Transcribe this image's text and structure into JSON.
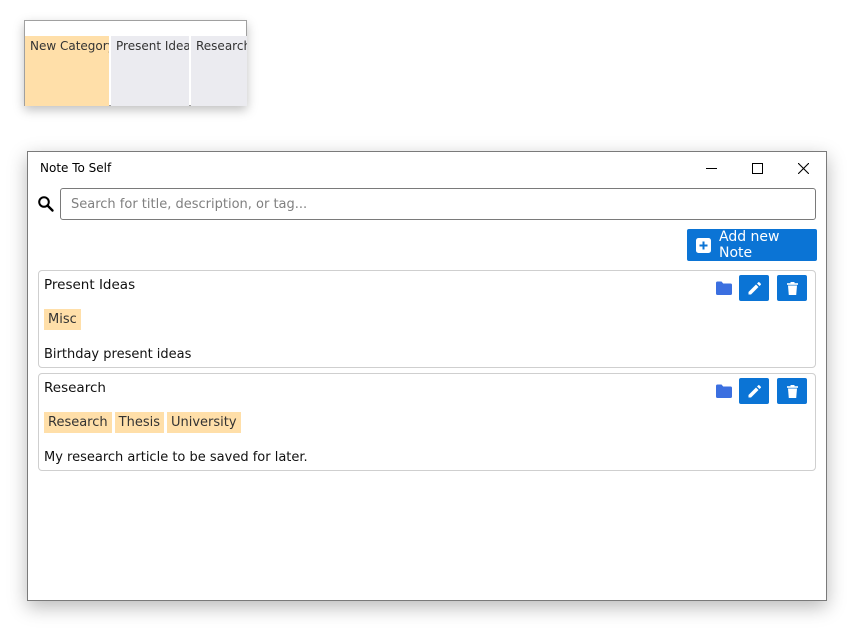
{
  "category_strip": {
    "categories": [
      {
        "label": "New Category",
        "color": "#ffdfa9"
      },
      {
        "label": "Present Ideas",
        "color": "#ebebf0"
      },
      {
        "label": "Research",
        "color": "#ebebf0"
      }
    ]
  },
  "window": {
    "title": "Note To Self",
    "controls": {
      "minimize": "minimize-icon",
      "maximize": "maximize-icon",
      "close": "close-icon"
    }
  },
  "search": {
    "placeholder": "Search for title, description, or tag...",
    "value": "",
    "icon": "search-icon"
  },
  "toolbar": {
    "add_label": "Add new Note",
    "accent_color": "#0b74d5"
  },
  "notes": [
    {
      "title": "Present Ideas",
      "tags": [
        "Misc"
      ],
      "description": "Birthday present ideas"
    },
    {
      "title": "Research",
      "tags": [
        "Research",
        "Thesis",
        "University"
      ],
      "description": "My research article to be saved for later."
    }
  ]
}
